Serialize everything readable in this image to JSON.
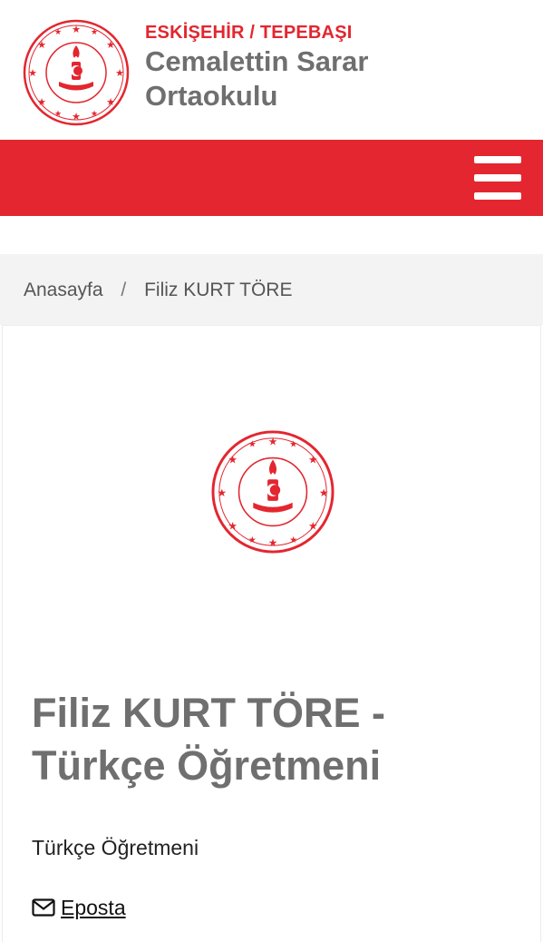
{
  "header": {
    "city": "ESKİŞEHİR / TEPEBAŞI",
    "school_line1": "Cemalettin Sarar",
    "school_line2": "Ortaokulu",
    "logo_text": "TÜRKİYE CUMHURİYETİ MİLLÎ EĞİTİM BAKANLIĞI"
  },
  "nav": {
    "menu_icon": "hamburger-menu-icon"
  },
  "breadcrumb": {
    "home": "Anasayfa",
    "separator": "/",
    "current": "Filiz KURT TÖRE"
  },
  "profile": {
    "title": "Filiz KURT TÖRE - Türkçe Öğretmeni",
    "role": "Türkçe Öğretmeni",
    "email_label": "Eposta",
    "email_icon": "envelope-icon"
  },
  "colors": {
    "brand_red": "#e3262f",
    "title_gray": "#6f6f6f",
    "breadcrumb_bg": "#f3f3f3"
  }
}
